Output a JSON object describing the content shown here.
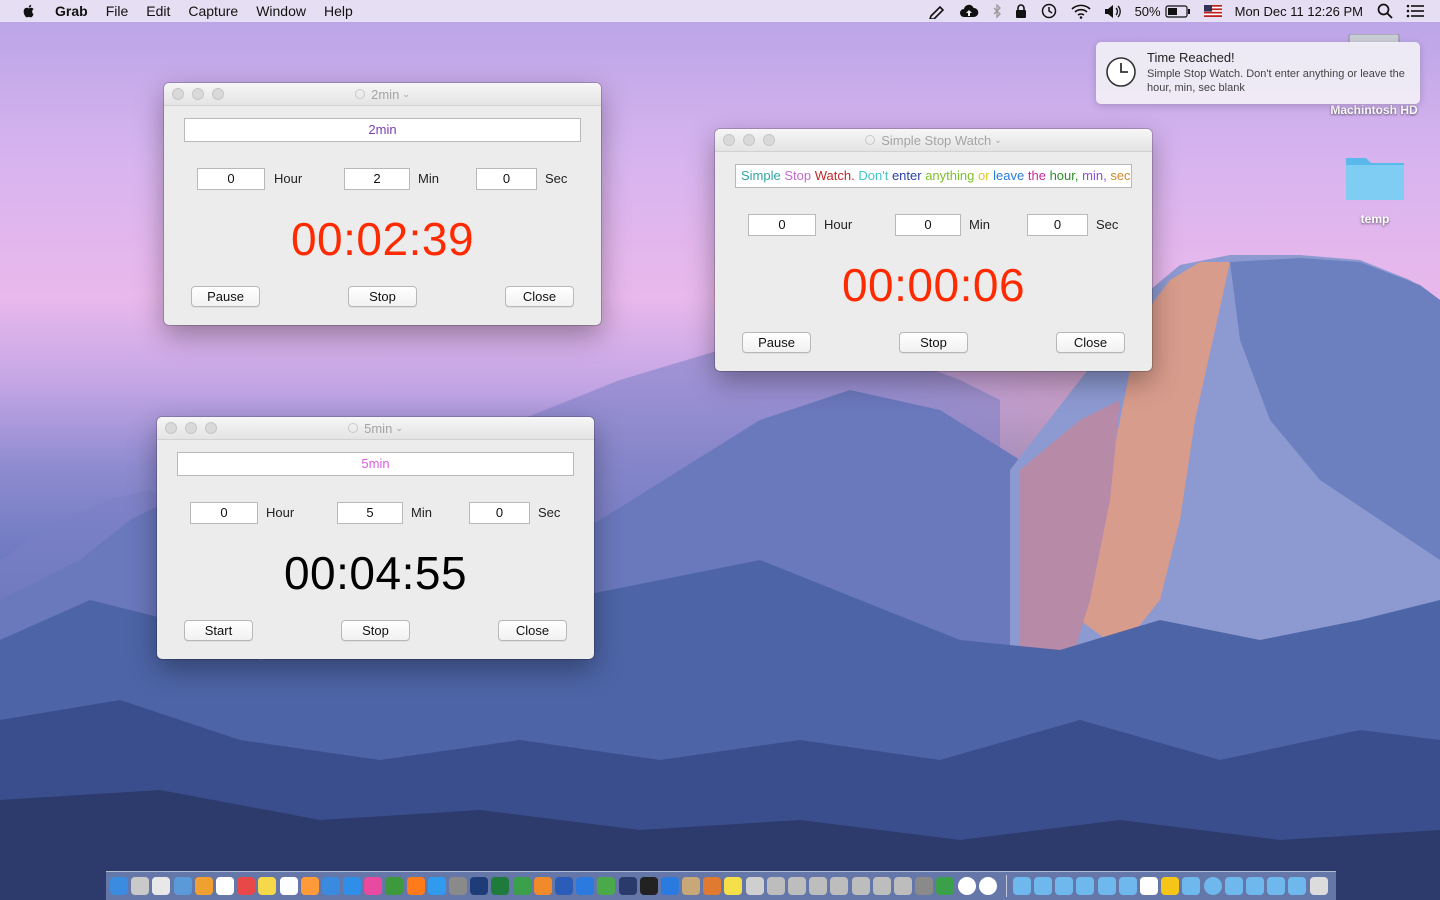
{
  "menubar": {
    "app": "Grab",
    "menus": [
      "File",
      "Edit",
      "Capture",
      "Window",
      "Help"
    ],
    "battery": "50%",
    "datetime": "Mon Dec 11  12:26 PM"
  },
  "notification": {
    "title": "Time Reached!",
    "body": "Simple Stop Watch. Don't enter anything or leave the hour, min, sec blank"
  },
  "desktop": {
    "icons": [
      "Machintosh HD",
      "temp"
    ]
  },
  "windows": {
    "w2": {
      "title": "2min",
      "name": "2min",
      "hour": "0",
      "min": "2",
      "sec": "0",
      "hour_label": "Hour",
      "min_label": "Min",
      "sec_label": "Sec",
      "timer": "00:02:39",
      "btn1": "Pause",
      "btn2": "Stop",
      "btn3": "Close"
    },
    "w5": {
      "title": "5min",
      "name": "5min",
      "hour": "0",
      "min": "5",
      "sec": "0",
      "hour_label": "Hour",
      "min_label": "Min",
      "sec_label": "Sec",
      "timer": "00:04:55",
      "btn1": "Start",
      "btn2": "Stop",
      "btn3": "Close"
    },
    "wsw": {
      "title": "Simple Stop Watch",
      "hour": "0",
      "min": "0",
      "sec": "0",
      "hour_label": "Hour",
      "min_label": "Min",
      "sec_label": "Sec",
      "timer": "00:00:06",
      "btn1": "Pause",
      "btn2": "Stop",
      "btn3": "Close",
      "name_words": [
        {
          "t": "Simple",
          "c": "#2fa7a0"
        },
        {
          "t": "Stop",
          "c": "#c46ad0"
        },
        {
          "t": "Watch.",
          "c": "#c0282a"
        },
        {
          "t": "Don't",
          "c": "#3ec7c7"
        },
        {
          "t": "enter",
          "c": "#2a3fa8"
        },
        {
          "t": "anything",
          "c": "#7fbf2a"
        },
        {
          "t": "or",
          "c": "#e0c42a"
        },
        {
          "t": "leave",
          "c": "#2a7bd6"
        },
        {
          "t": "the",
          "c": "#c42a9a"
        },
        {
          "t": "hour,",
          "c": "#2f8a2a"
        },
        {
          "t": "min,",
          "c": "#8a4fd0"
        },
        {
          "t": "sec",
          "c": "#d08a2a"
        }
      ]
    }
  },
  "colors": {
    "timer_running": "#ff2a00",
    "timer_stopped": "#000000",
    "name_2min": "#7a3fb0",
    "name_5min": "#e05ae8"
  },
  "dock_apps": [
    "finder",
    "launchpad",
    "preview",
    "mail-preview",
    "contacts",
    "calendar",
    "reminders",
    "notes",
    "textedit",
    "photos",
    "xcode",
    "app-store",
    "itunes",
    "chrome",
    "firefox",
    "safari",
    "script",
    "photoshop",
    "excel",
    "numbers",
    "pages",
    "word",
    "keynote",
    "maps",
    "quicktime",
    "terminal",
    "finder2",
    "misc",
    "books",
    "stickies",
    "installer",
    "installer2",
    "installer3",
    "installer4",
    "installer5",
    "installer6",
    "installer7",
    "installer8",
    "archive",
    "drive",
    "clock",
    "clock2",
    "folder",
    "mail",
    "users",
    "folder2",
    "folder3",
    "folder4",
    "home",
    "norton",
    "tools",
    "x-app",
    "finder3",
    "downloads",
    "folder5",
    "folder6",
    "trash"
  ]
}
